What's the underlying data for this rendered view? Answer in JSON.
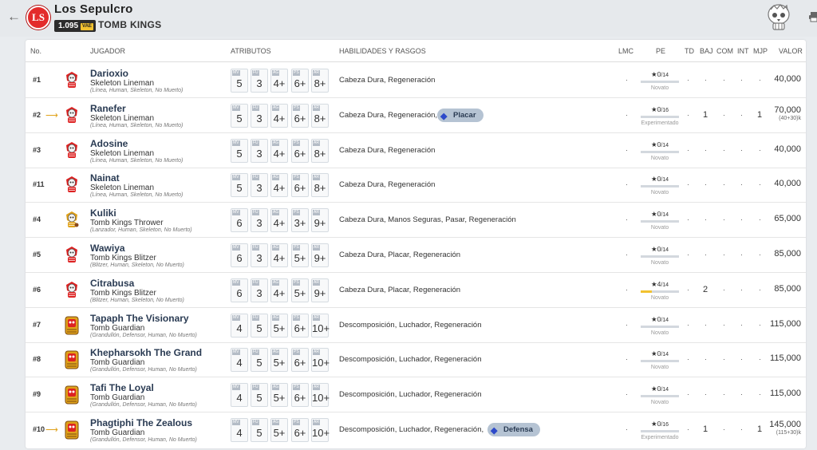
{
  "header": {
    "team_name": "Los Sepulcro",
    "logo_text": "LS",
    "vae_value": "1.095",
    "vae_label": "VAE",
    "race": "TOMB KINGS"
  },
  "columns": {
    "num": "No.",
    "player": "JUGADOR",
    "attrs": "ATRIBUTOS",
    "skills": "HABILIDADES Y RASGOS",
    "lmc": "LMC",
    "pe": "PE",
    "td": "TD",
    "baj": "BAJ",
    "com": "COM",
    "int": "INT",
    "mjp": "MJP",
    "value": "VALOR"
  },
  "stat_labels": [
    "MV",
    "FU",
    "AG",
    "PS",
    "AR"
  ],
  "players": [
    {
      "num": "#1",
      "trend": "",
      "name": "Darioxio",
      "position": "Skeleton Lineman",
      "keywords": "(Línea, Human, Skeleton, No Muerto)",
      "stats": [
        "5",
        "3",
        "4+",
        "6+",
        "8+"
      ],
      "skills": "Cabeza Dura, Regeneración",
      "extra_skill": "",
      "lmc": "·",
      "pe": "0",
      "pe_max": "/14",
      "pe_fill": 0,
      "pe_label": "Novato",
      "td": "·",
      "baj": "·",
      "com": "·",
      "int": "·",
      "mjp": "·",
      "value": "40,000",
      "value_sub": "",
      "avatar": "skeleton",
      "av_color": "#d22"
    },
    {
      "num": "#2",
      "trend": "⟶",
      "name": "Ranefer",
      "position": "Skeleton Lineman",
      "keywords": "(Línea, Human, Skeleton, No Muerto)",
      "stats": [
        "5",
        "3",
        "4+",
        "6+",
        "8+"
      ],
      "skills": "Cabeza Dura, Regeneración,",
      "extra_skill": "Placar",
      "lmc": "·",
      "pe": "0",
      "pe_max": "/16",
      "pe_fill": 0,
      "pe_label": "Experimentado",
      "td": "·",
      "baj": "1",
      "com": "·",
      "int": "·",
      "mjp": "1",
      "value": "70,000",
      "value_sub": "(40+30)k",
      "avatar": "skeleton",
      "av_color": "#d22"
    },
    {
      "num": "#3",
      "trend": "",
      "name": "Adosine",
      "position": "Skeleton Lineman",
      "keywords": "(Línea, Human, Skeleton, No Muerto)",
      "stats": [
        "5",
        "3",
        "4+",
        "6+",
        "8+"
      ],
      "skills": "Cabeza Dura, Regeneración",
      "extra_skill": "",
      "lmc": "·",
      "pe": "0",
      "pe_max": "/14",
      "pe_fill": 0,
      "pe_label": "Novato",
      "td": "·",
      "baj": "·",
      "com": "·",
      "int": "·",
      "mjp": "·",
      "value": "40,000",
      "value_sub": "",
      "avatar": "skeleton",
      "av_color": "#d22"
    },
    {
      "num": "#11",
      "trend": "",
      "name": "Nainat",
      "position": "Skeleton Lineman",
      "keywords": "(Línea, Human, Skeleton, No Muerto)",
      "stats": [
        "5",
        "3",
        "4+",
        "6+",
        "8+"
      ],
      "skills": "Cabeza Dura, Regeneración",
      "extra_skill": "",
      "lmc": "·",
      "pe": "0",
      "pe_max": "/14",
      "pe_fill": 0,
      "pe_label": "Novato",
      "td": "·",
      "baj": "·",
      "com": "·",
      "int": "·",
      "mjp": "·",
      "value": "40,000",
      "value_sub": "",
      "avatar": "skeleton",
      "av_color": "#d22"
    },
    {
      "num": "#4",
      "trend": "",
      "name": "Kuliki",
      "position": "Tomb Kings Thrower",
      "keywords": "(Lanzador, Human, Skeleton, No Muerto)",
      "stats": [
        "6",
        "3",
        "4+",
        "3+",
        "9+"
      ],
      "skills": "Cabeza Dura, Manos Seguras, Pasar, Regeneración",
      "extra_skill": "",
      "lmc": "·",
      "pe": "0",
      "pe_max": "/14",
      "pe_fill": 0,
      "pe_label": "Novato",
      "td": "·",
      "baj": "·",
      "com": "·",
      "int": "·",
      "mjp": "·",
      "value": "65,000",
      "value_sub": "",
      "avatar": "thrower",
      "av_color": "#e0a21a"
    },
    {
      "num": "#5",
      "trend": "",
      "name": "Wawiya",
      "position": "Tomb Kings Blitzer",
      "keywords": "(Blitzer, Human, Skeleton, No Muerto)",
      "stats": [
        "6",
        "3",
        "4+",
        "5+",
        "9+"
      ],
      "skills": "Cabeza Dura, Placar, Regeneración",
      "extra_skill": "",
      "lmc": "·",
      "pe": "0",
      "pe_max": "/14",
      "pe_fill": 0,
      "pe_label": "Novato",
      "td": "·",
      "baj": "·",
      "com": "·",
      "int": "·",
      "mjp": "·",
      "value": "85,000",
      "value_sub": "",
      "avatar": "blitzer",
      "av_color": "#d22"
    },
    {
      "num": "#6",
      "trend": "",
      "name": "Citrabusa",
      "position": "Tomb Kings Blitzer",
      "keywords": "(Blitzer, Human, Skeleton, No Muerto)",
      "stats": [
        "6",
        "3",
        "4+",
        "5+",
        "9+"
      ],
      "skills": "Cabeza Dura, Placar, Regeneración",
      "extra_skill": "",
      "lmc": "·",
      "pe": "4",
      "pe_max": "/14",
      "pe_fill": 0.286,
      "pe_label": "Novato",
      "td": "·",
      "baj": "2",
      "com": "·",
      "int": "·",
      "mjp": "·",
      "value": "85,000",
      "value_sub": "",
      "avatar": "blitzer",
      "av_color": "#d22"
    },
    {
      "num": "#7",
      "trend": "",
      "name": "Tapaph The Visionary",
      "position": "Tomb Guardian",
      "keywords": "(Grandullón, Defensor, Human, No Muerto)",
      "stats": [
        "4",
        "5",
        "5+",
        "6+",
        "10+"
      ],
      "skills": "Descomposición, Luchador, Regeneración",
      "extra_skill": "",
      "lmc": "·",
      "pe": "0",
      "pe_max": "/14",
      "pe_fill": 0,
      "pe_label": "Novato",
      "td": "·",
      "baj": "·",
      "com": "·",
      "int": "·",
      "mjp": "·",
      "value": "115,000",
      "value_sub": "",
      "avatar": "guardian",
      "av_color": "#e0a21a"
    },
    {
      "num": "#8",
      "trend": "",
      "name": "Khepharsokh The Grand",
      "position": "Tomb Guardian",
      "keywords": "(Grandullón, Defensor, Human, No Muerto)",
      "stats": [
        "4",
        "5",
        "5+",
        "6+",
        "10+"
      ],
      "skills": "Descomposición, Luchador, Regeneración",
      "extra_skill": "",
      "lmc": "·",
      "pe": "0",
      "pe_max": "/14",
      "pe_fill": 0,
      "pe_label": "Novato",
      "td": "·",
      "baj": "·",
      "com": "·",
      "int": "·",
      "mjp": "·",
      "value": "115,000",
      "value_sub": "",
      "avatar": "guardian",
      "av_color": "#e0a21a"
    },
    {
      "num": "#9",
      "trend": "",
      "name": "Tafi The Loyal",
      "position": "Tomb Guardian",
      "keywords": "(Grandullón, Defensor, Human, No Muerto)",
      "stats": [
        "4",
        "5",
        "5+",
        "6+",
        "10+"
      ],
      "skills": "Descomposición, Luchador, Regeneración",
      "extra_skill": "",
      "lmc": "·",
      "pe": "0",
      "pe_max": "/14",
      "pe_fill": 0,
      "pe_label": "Novato",
      "td": "·",
      "baj": "·",
      "com": "·",
      "int": "·",
      "mjp": "·",
      "value": "115,000",
      "value_sub": "",
      "avatar": "guardian",
      "av_color": "#e0a21a"
    },
    {
      "num": "#10",
      "trend": "⟶",
      "name": "Phagtiphi The Zealous",
      "position": "Tomb Guardian",
      "keywords": "(Grandullón, Defensor, Human, No Muerto)",
      "stats": [
        "4",
        "5",
        "5+",
        "6+",
        "10+"
      ],
      "skills": "Descomposición, Luchador, Regeneración,",
      "extra_skill": "Defensa",
      "lmc": "·",
      "pe": "0",
      "pe_max": "/16",
      "pe_fill": 0,
      "pe_label": "Experimentado",
      "td": "·",
      "baj": "1",
      "com": "·",
      "int": "·",
      "mjp": "1",
      "value": "145,000",
      "value_sub": "(115+30)k",
      "avatar": "guardian",
      "av_color": "#e0a21a"
    }
  ]
}
